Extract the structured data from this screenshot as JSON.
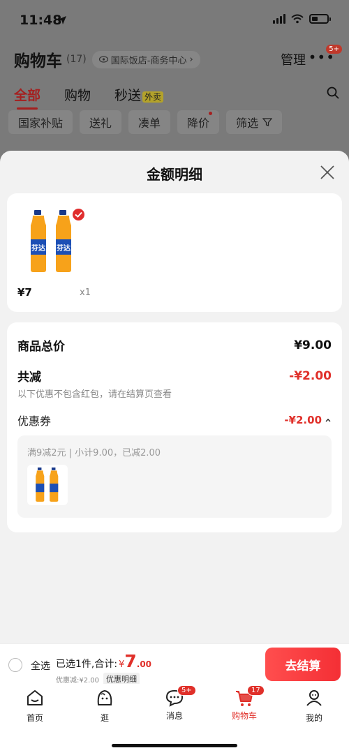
{
  "status_bar": {
    "time": "11:48"
  },
  "header": {
    "title": "购物车",
    "count": "(17)",
    "address": "国际饭店-商务中心",
    "manage": "管理",
    "more_badge": "5+"
  },
  "category_tabs": [
    {
      "label": "全部",
      "active": true
    },
    {
      "label": "购物"
    },
    {
      "label": "秒送",
      "tag": "外卖"
    }
  ],
  "filters": [
    "国家补贴",
    "送礼",
    "凑单",
    "降价",
    "筛选"
  ],
  "sheet": {
    "title": "金额明细",
    "product": {
      "price": "¥7",
      "quantity": "x1"
    },
    "total_label": "商品总价",
    "total_value": "¥9.00",
    "discount_label": "共减",
    "discount_value": "-¥2.00",
    "note": "以下优惠不包含红包，请在结算页查看",
    "coupon_label": "优惠券",
    "coupon_value": "-¥2.00",
    "coupon_detail": "满9减2元 | 小计9.00，已减2.00"
  },
  "checkout": {
    "select_all": "全选",
    "selected_text": "已选1件,合计:",
    "currency": "¥",
    "total_integer": "7",
    "total_decimal": ".00",
    "discount_text": "优惠减:¥2.00",
    "detail_tag": "优惠明细",
    "button": "去结算"
  },
  "tabbar": [
    {
      "label": "首页",
      "icon": "home-icon"
    },
    {
      "label": "逛",
      "icon": "stroll-icon"
    },
    {
      "label": "消息",
      "icon": "message-icon",
      "badge": "5+"
    },
    {
      "label": "购物车",
      "icon": "cart-icon",
      "badge": "17",
      "active": true
    },
    {
      "label": "我的",
      "icon": "profile-icon"
    }
  ],
  "colors": {
    "accent": "#e0302a",
    "overlay": "#7a7a7a",
    "sheet_bg": "#f2f2f2"
  }
}
